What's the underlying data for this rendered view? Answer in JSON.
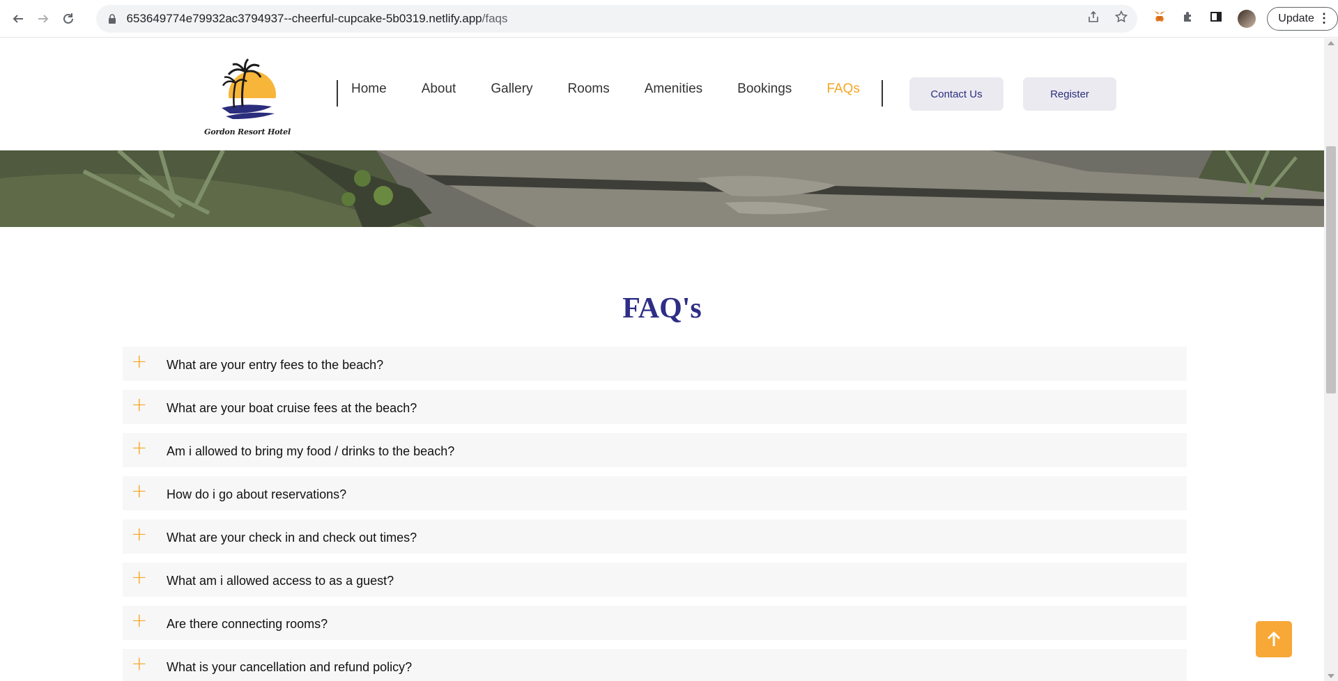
{
  "browser": {
    "url_host": "653649774e79932ac3794937--cheerful-cupcake-5b0319.netlify.app",
    "url_path": "/faqs",
    "update_label": "Update"
  },
  "site": {
    "logo_text": "Gordon Resort Hotel",
    "nav": [
      {
        "label": "Home",
        "active": false
      },
      {
        "label": "About",
        "active": false
      },
      {
        "label": "Gallery",
        "active": false
      },
      {
        "label": "Rooms",
        "active": false
      },
      {
        "label": "Amenities",
        "active": false
      },
      {
        "label": "Bookings",
        "active": false
      },
      {
        "label": "FAQs",
        "active": true
      }
    ],
    "contact_label": "Contact Us",
    "register_label": "Register"
  },
  "faq": {
    "title": "FAQ's",
    "items": [
      "What are your entry fees to the beach?",
      "What are your boat cruise fees at the beach?",
      "Am i allowed to bring my food / drinks to the beach?",
      "How do i go about reservations?",
      "What are your check in and check out times?",
      "What am i allowed access to as a guest?",
      "Are there connecting rooms?",
      "What is your cancellation and refund policy?"
    ]
  },
  "colors": {
    "accent": "#f5a623",
    "brand_navy": "#2e2e86",
    "button_bg": "#eceaf1"
  }
}
